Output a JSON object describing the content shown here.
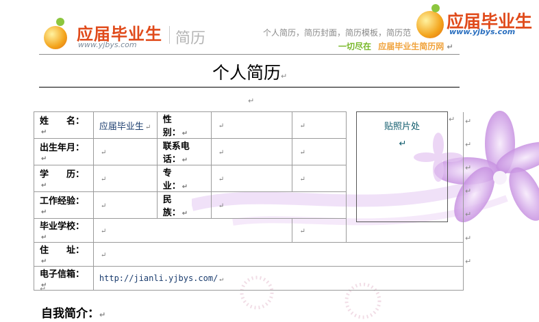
{
  "header": {
    "brand_cn": "应届毕业生",
    "brand_url": "www.yjbys.com",
    "resume_tag": "简历",
    "slogan_line1": "个人简历，简历封面，简历模板，简历范",
    "slogan_line2_a": "一切尽在",
    "slogan_line2_b": "应届毕业生简历网",
    "right_brand_cn": "应届毕业生",
    "right_brand_url": "www.yjbys.com"
  },
  "title": "个人简历",
  "mark": "↵",
  "form": {
    "name_label": "姓　　名：",
    "name_value": "应届毕业生",
    "gender_label": "性　　别：",
    "birth_label": "出生年月：",
    "phone_label": "联系电话：",
    "edu_label": "学　　历：",
    "major_label": "专　　业：",
    "work_label": "工作经验：",
    "ethnic_label": "民　　族：",
    "school_label": "毕业学校：",
    "address_label": "住　　址：",
    "email_label": "电子信箱：",
    "email_value": "http://jianli.yjbys.com/",
    "photo_label": "贴照片处"
  },
  "intro_heading": "自我简介："
}
